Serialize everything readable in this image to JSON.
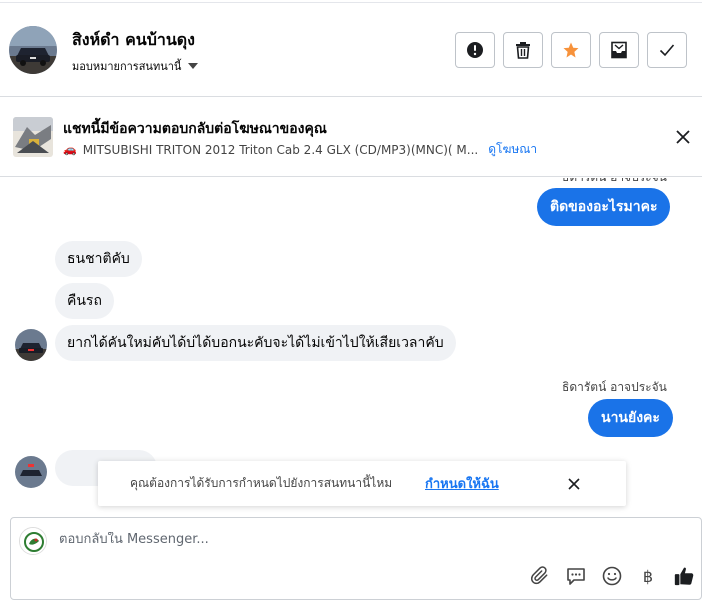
{
  "header": {
    "contact_name": "สิงห์ดำ คนบ้านดุง",
    "assign_label": "มอบหมายการสนทนานี้",
    "actions": [
      "mark-spam",
      "delete",
      "star",
      "move-to-inbox",
      "mark-done"
    ]
  },
  "ad_banner": {
    "title": "แชทนี้มีข้อความตอบกลับต่อโฆษณาของคุณ",
    "ad_text": "MITSUBISHI TRITON 2012 Triton Cab 2.4 GLX (CD/MP3)(MNC)( M...",
    "view_ad_link": "ดูโฆษณา"
  },
  "messages": {
    "top_sender_partial": "ธิดารัตน์ อาจประจัน",
    "m1_out": "ติดของอะไรมาคะ",
    "m2_in": "ธนชาติคับ",
    "m3_in": "คืนรถ",
    "m4_in": "ยากได้คันใหม่คับได้บ่ได้บอกนะคับจะได้ไม่เข้าไปให้เสียเวลาคับ",
    "sender_label": "ธิดารัตน์ อาจประจัน",
    "m5_out": "นานยังคะ"
  },
  "reminder": {
    "text": "คุณต้องการได้รับการกำหนดไปยังการสนทนานี้ไหม",
    "link": "กำหนดให้ฉัน"
  },
  "composer": {
    "placeholder": "ตอบกลับใน Messenger...",
    "currency_symbol": "฿"
  },
  "colors": {
    "accent": "#1876f2",
    "outgoing_bubble": "#1a73e8",
    "incoming_bubble": "#f0f2f5",
    "star": "#f7923b"
  }
}
